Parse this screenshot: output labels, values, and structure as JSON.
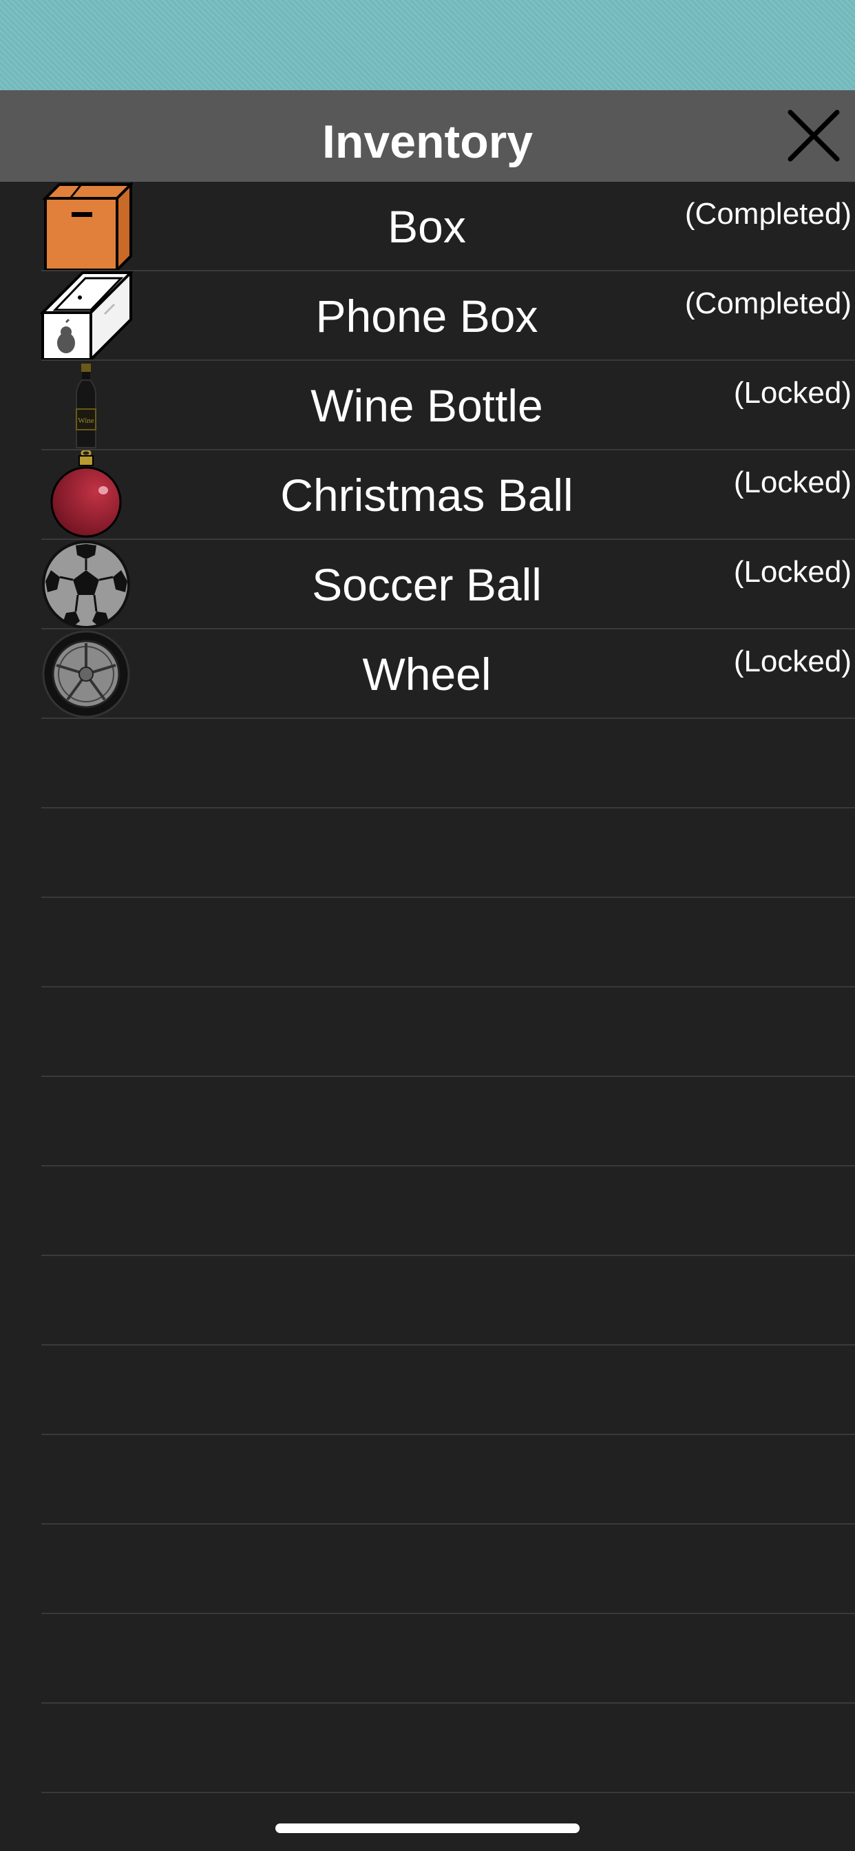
{
  "header": {
    "title": "Inventory",
    "close_icon": "close-icon"
  },
  "items": [
    {
      "name": "Box",
      "status": "(Completed)",
      "icon": "cardboard-box-icon"
    },
    {
      "name": "Phone Box",
      "status": "(Completed)",
      "icon": "phone-box-icon"
    },
    {
      "name": "Wine Bottle",
      "status": "(Locked)",
      "icon": "wine-bottle-icon",
      "label_text": "Wine"
    },
    {
      "name": "Christmas Ball",
      "status": "(Locked)",
      "icon": "christmas-ball-icon"
    },
    {
      "name": "Soccer Ball",
      "status": "(Locked)",
      "icon": "soccer-ball-icon"
    },
    {
      "name": "Wheel",
      "status": "(Locked)",
      "icon": "wheel-icon"
    }
  ],
  "empty_rows": 12,
  "colors": {
    "top_strip": "#78bdc0",
    "header": "#585858",
    "background": "#212121",
    "divider": "#3a3a3a",
    "box_orange": "#e0803a",
    "ball_red": "#8e1d2c"
  }
}
